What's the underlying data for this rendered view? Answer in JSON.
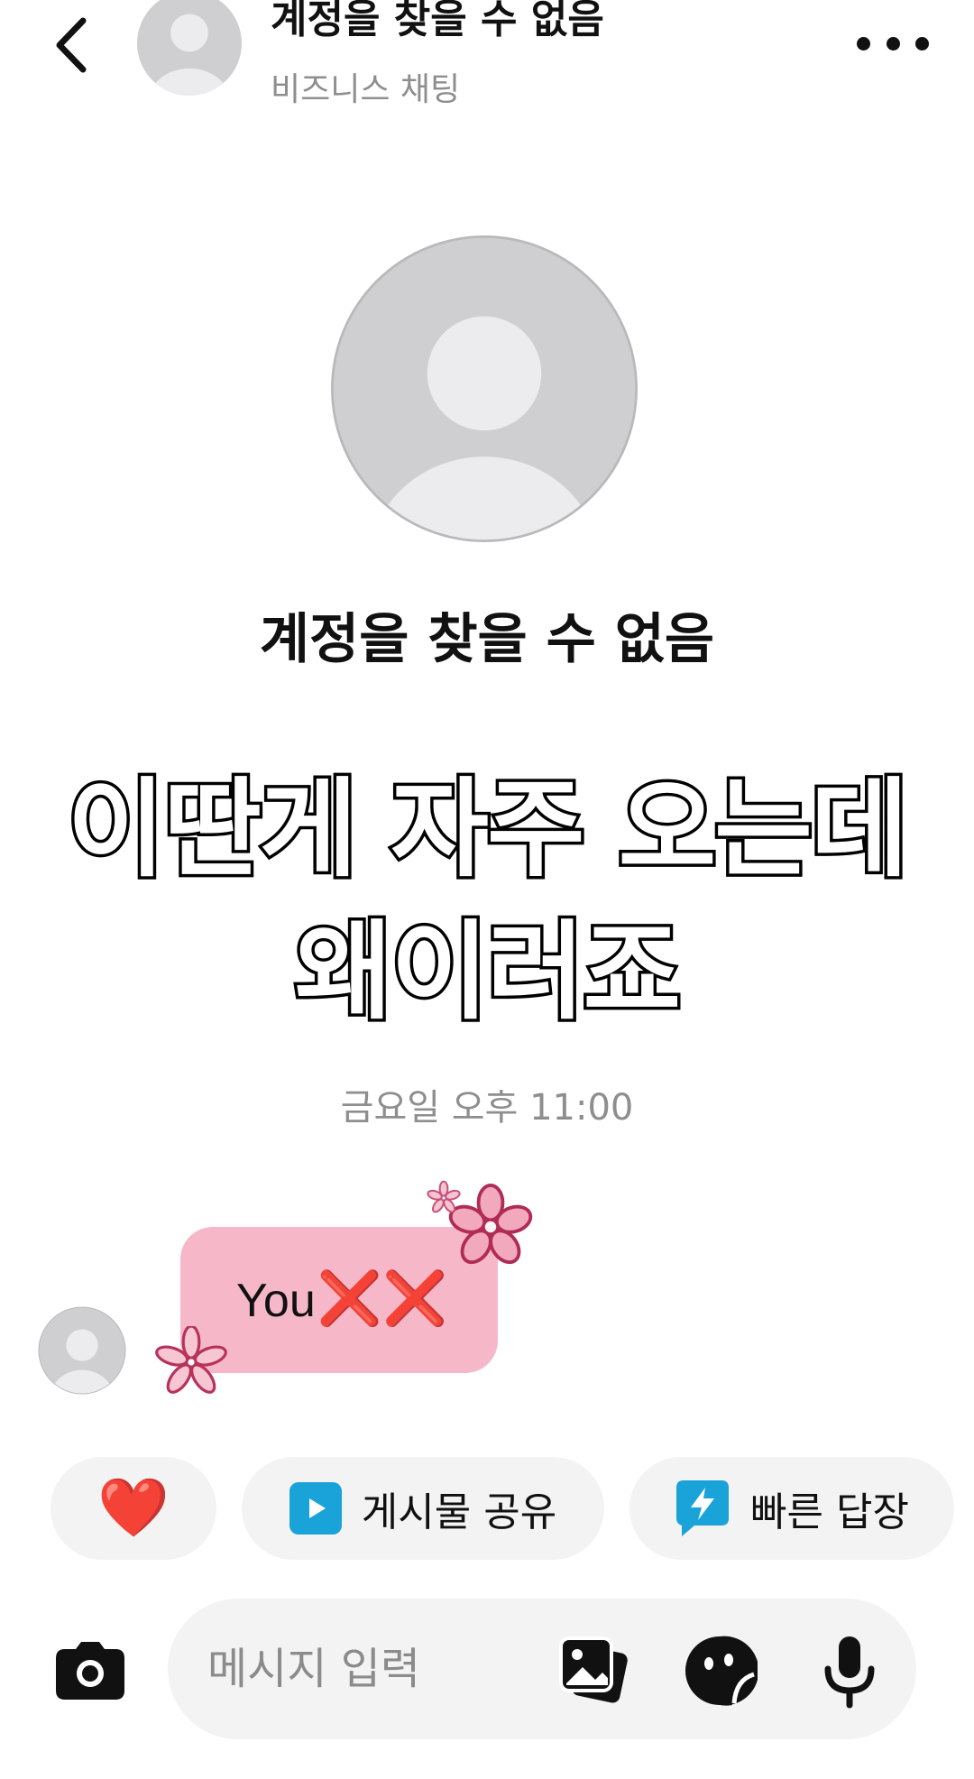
{
  "header": {
    "title": "계정을 찾을 수 없음",
    "subtitle": "비즈니스 채팅"
  },
  "profile": {
    "name": "계정을 찾을 수 없음"
  },
  "caption": {
    "line1": "이딴게 자주 오는데",
    "line2": "왜이러죠"
  },
  "thread": {
    "timestamp": "금요일 오후 11:00",
    "message": {
      "text": "You",
      "emoji": "❌❌",
      "bubble_color": "#f6b8c9"
    }
  },
  "quick_actions": {
    "heart_icon": "❤️",
    "share_post": "게시물 공유",
    "quick_reply": "빠른 답장",
    "accent_color": "#1aa3d8"
  },
  "composer": {
    "placeholder": "메시지 입력"
  },
  "icons": {
    "back": "chevron-left-icon",
    "more": "more-horizontal-icon",
    "camera": "camera-icon",
    "gallery": "gallery-icon",
    "sticker": "sticker-icon",
    "mic": "mic-icon"
  }
}
